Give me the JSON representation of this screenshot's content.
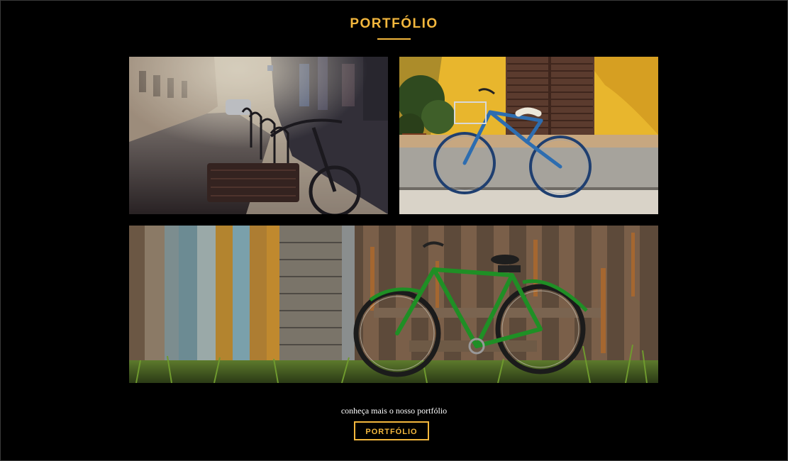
{
  "section": {
    "title": "PORTFÓLIO"
  },
  "gallery": {
    "images": [
      {
        "subject": "bicycles parked on a sunlit city street"
      },
      {
        "subject": "blue bicycle against a yellow wall"
      },
      {
        "subject": "green bicycle against a weathered wooden fence"
      }
    ]
  },
  "cta": {
    "text": "conheça mais o nosso portfólio",
    "button_label": "PORTFÓLIO"
  },
  "colors": {
    "background": "#000000",
    "accent": "#f3b73d",
    "text": "#ffffff"
  }
}
